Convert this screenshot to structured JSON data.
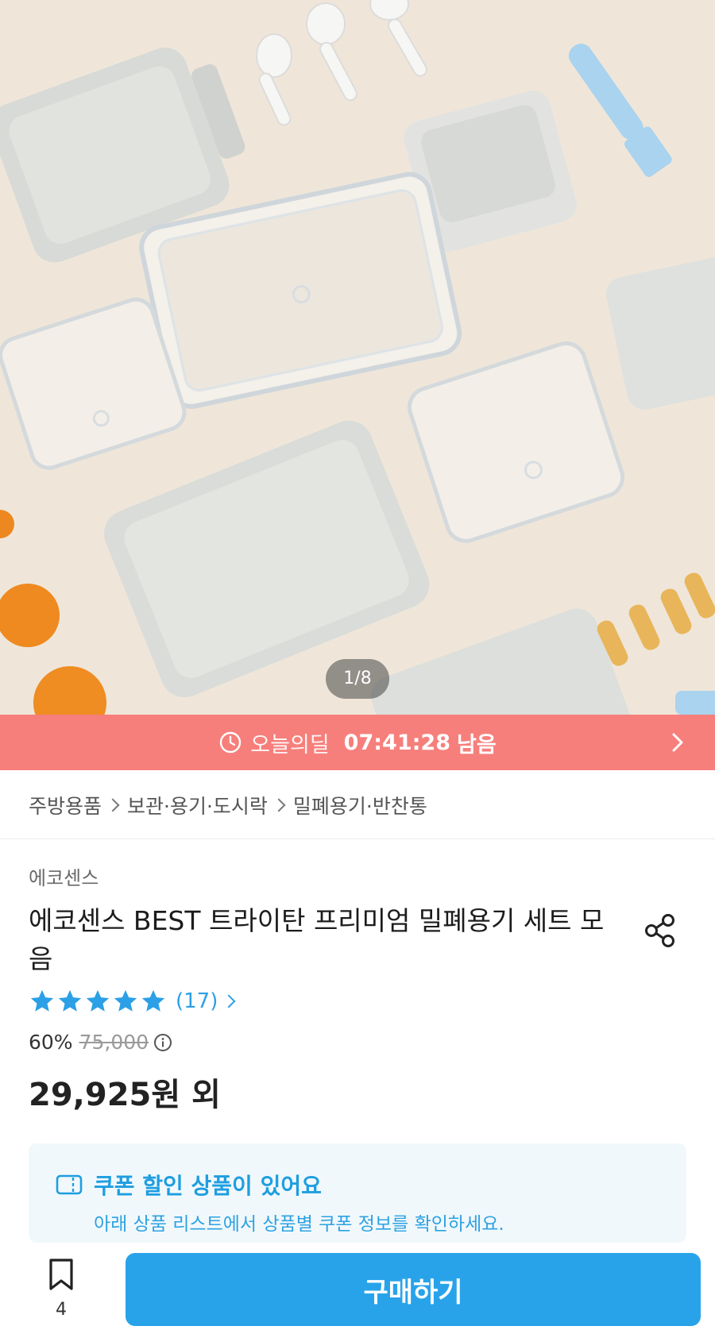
{
  "gallery": {
    "current": "1/8"
  },
  "deal": {
    "label": "오늘의딜",
    "time": "07:41:28",
    "suffix": "남음"
  },
  "breadcrumb": {
    "items": [
      "주방용품",
      "보관·용기·도시락",
      "밀폐용기·반찬통"
    ]
  },
  "product": {
    "brand": "에코센스",
    "title": "에코센스 BEST 트라이탄 프리미엄 밀폐용기 세트 모음",
    "rating_count": "(17)",
    "stars": 5,
    "discount": "60%",
    "original_price": "75,000",
    "price": "29,925원 외"
  },
  "coupon": {
    "title": "쿠폰 할인 상품이 있어요",
    "desc": "아래 상품 리스트에서 상품별 쿠폰 정보를 확인하세요."
  },
  "bottom_bar": {
    "bookmark_count": "4",
    "buy_label": "구매하기"
  },
  "colors": {
    "accent": "#28a3ea",
    "deal": "#f67f7c",
    "star": "#2ba0e6"
  }
}
